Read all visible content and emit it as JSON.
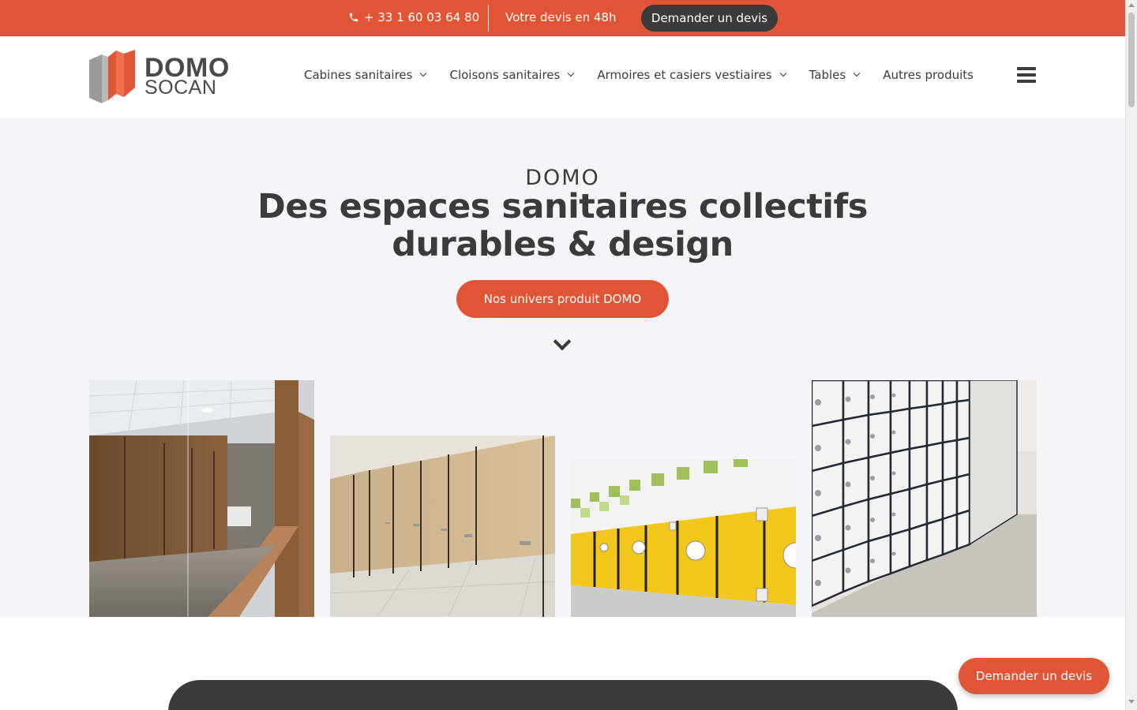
{
  "topbar": {
    "phone_icon": "phone-icon",
    "phone": "+ 33 1 60 03 64 80",
    "quote_time": "Votre devis en 48h",
    "quote_button": "Demander un devis"
  },
  "header": {
    "logo_line1": "DOMO",
    "logo_line2": "SOCAN",
    "nav": [
      {
        "label": "Cabines sanitaires",
        "has_dropdown": true
      },
      {
        "label": "Cloisons sanitaires",
        "has_dropdown": true
      },
      {
        "label": "Armoires et casiers vestiaires",
        "has_dropdown": true
      },
      {
        "label": "Tables",
        "has_dropdown": true
      },
      {
        "label": "Autres produits",
        "has_dropdown": false
      }
    ],
    "menu_icon": "hamburger-menu-icon"
  },
  "hero": {
    "eyebrow": "DOMO",
    "headline_line1": "Des espaces sanitaires collectifs",
    "headline_line2": "durables & design",
    "cta": "Nos univers produit DOMO",
    "scroll_icon": "chevron-down-icon",
    "photos": [
      "Cabines sanitaires bois avec miroir",
      "Cloisons sanitaires bois clair",
      "Cabines sanitaires jaunes",
      "Casiers vestiaires blancs"
    ]
  },
  "floating": {
    "quote_button": "Demander un devis"
  },
  "colors": {
    "accent": "#e05535",
    "dark": "#3b3b3b",
    "hero_bg": "#f5f4f8"
  }
}
